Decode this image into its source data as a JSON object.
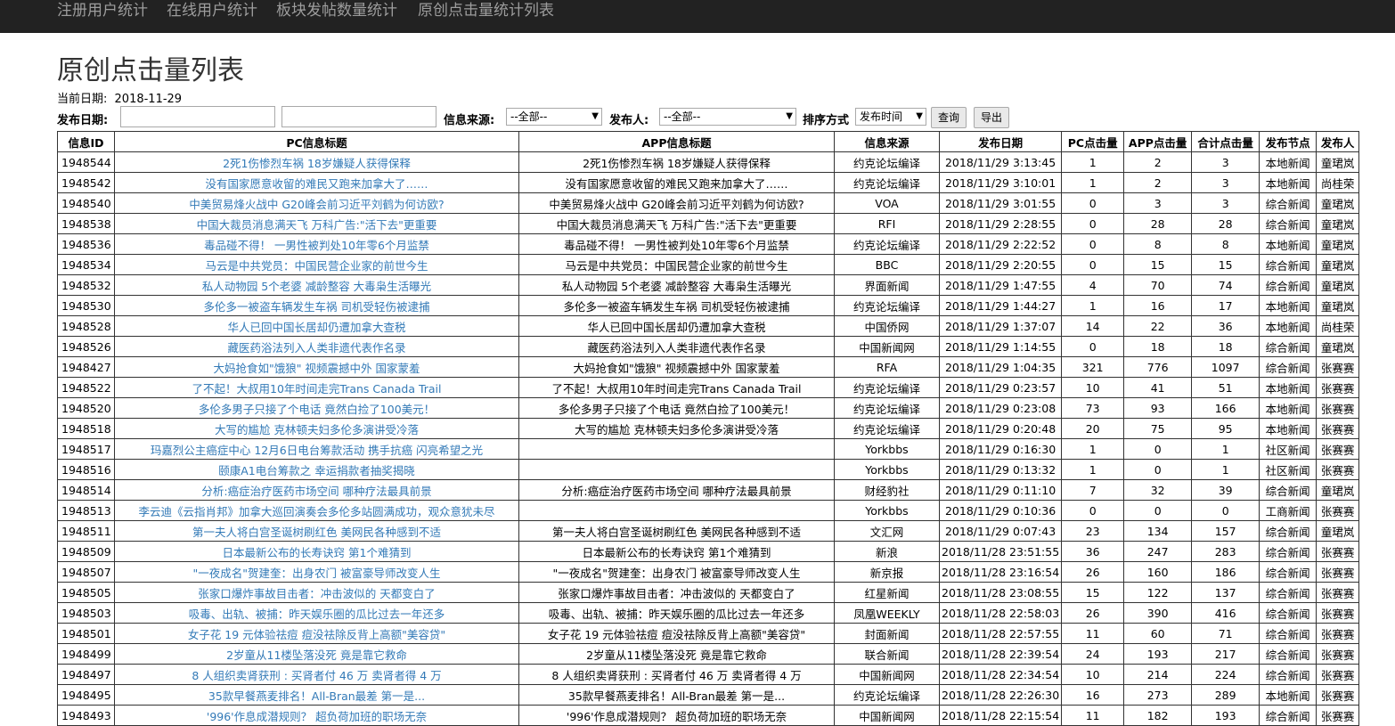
{
  "nav": {
    "items": [
      {
        "label": "注册用户统计"
      },
      {
        "label": "在线用户统计"
      },
      {
        "label": "板块发帖数量统计"
      },
      {
        "label": "原创点击量统计列表"
      }
    ]
  },
  "page_title": "原创点击量列表",
  "current_date": {
    "label": "当前日期:",
    "value": "2018-11-29"
  },
  "filters": {
    "publish_date_label": "发布日期:",
    "source_label": "信息来源:",
    "source_value": "--全部--",
    "publisher_label": "发布人:",
    "publisher_value": "--全部--",
    "sort_label": "排序方式",
    "sort_value": "发布时间",
    "query_button": "查询",
    "export_button": "导出"
  },
  "table": {
    "headers": [
      "信息ID",
      "PC信息标题",
      "APP信息标题",
      "信息来源",
      "发布日期",
      "PC点击量",
      "APP点击量",
      "合计点击量",
      "发布节点",
      "发布人"
    ],
    "rows": [
      [
        "1948544",
        "2死1伤惨烈车祸 18岁嫌疑人获得保释",
        "2死1伤惨烈车祸 18岁嫌疑人获得保释",
        "约克论坛编译",
        "2018/11/29 3:13:45",
        "1",
        "2",
        "3",
        "本地新闻",
        "童珺岚"
      ],
      [
        "1948542",
        "没有国家愿意收留的难民又跑来加拿大了……",
        "没有国家愿意收留的难民又跑来加拿大了……",
        "约克论坛编译",
        "2018/11/29 3:10:01",
        "1",
        "2",
        "3",
        "本地新闻",
        "尚桂荣"
      ],
      [
        "1948540",
        "中美贸易烽火战中 G20峰会前习近平刘鹤为何访欧?",
        "中美贸易烽火战中 G20峰会前习近平刘鹤为何访欧?",
        "VOA",
        "2018/11/29 3:01:55",
        "0",
        "3",
        "3",
        "综合新闻",
        "童珺岚"
      ],
      [
        "1948538",
        "中国大裁员消息满天飞 万科广告:\"活下去\"更重要",
        "中国大裁员消息满天飞 万科广告:\"活下去\"更重要",
        "RFI",
        "2018/11/29 2:28:55",
        "0",
        "28",
        "28",
        "综合新闻",
        "童珺岚"
      ],
      [
        "1948536",
        "毒品碰不得！ 一男性被判处10年零6个月监禁",
        "毒品碰不得！ 一男性被判处10年零6个月监禁",
        "约克论坛编译",
        "2018/11/29 2:22:52",
        "0",
        "8",
        "8",
        "本地新闻",
        "童珺岚"
      ],
      [
        "1948534",
        "马云是中共党员：中国民营企业家的前世今生",
        "马云是中共党员：中国民营企业家的前世今生",
        "BBC",
        "2018/11/29 2:20:55",
        "0",
        "15",
        "15",
        "综合新闻",
        "童珺岚"
      ],
      [
        "1948532",
        "私人动物园 5个老婆 减龄整容 大毒枭生活曝光",
        "私人动物园 5个老婆 减龄整容 大毒枭生活曝光",
        "界面新闻",
        "2018/11/29 1:47:55",
        "4",
        "70",
        "74",
        "综合新闻",
        "童珺岚"
      ],
      [
        "1948530",
        "多伦多一被盗车辆发生车祸 司机受轻伤被逮捕",
        "多伦多一被盗车辆发生车祸 司机受轻伤被逮捕",
        "约克论坛编译",
        "2018/11/29 1:44:27",
        "1",
        "16",
        "17",
        "本地新闻",
        "童珺岚"
      ],
      [
        "1948528",
        "华人已回中国长居却仍遭加拿大查税",
        "华人已回中国长居却仍遭加拿大查税",
        "中国侨网",
        "2018/11/29 1:37:07",
        "14",
        "22",
        "36",
        "本地新闻",
        "尚桂荣"
      ],
      [
        "1948526",
        "藏医药浴法列入人类非遗代表作名录",
        "藏医药浴法列入人类非遗代表作名录",
        "中国新闻网",
        "2018/11/29 1:14:55",
        "0",
        "18",
        "18",
        "综合新闻",
        "童珺岚"
      ],
      [
        "1948427",
        "大妈抢食如\"饿狼\" 视频震撼中外 国家蒙羞",
        "大妈抢食如\"饿狼\" 视频震撼中外 国家蒙羞",
        "RFA",
        "2018/11/29 1:04:35",
        "321",
        "776",
        "1097",
        "综合新闻",
        "张赛赛"
      ],
      [
        "1948522",
        "了不起！大叔用10年时间走完Trans Canada Trail",
        "了不起！大叔用10年时间走完Trans Canada Trail",
        "约克论坛编译",
        "2018/11/29 0:23:57",
        "10",
        "41",
        "51",
        "本地新闻",
        "张赛赛"
      ],
      [
        "1948520",
        "多伦多男子只接了个电话 竟然白捡了100美元！",
        "多伦多男子只接了个电话 竟然白捡了100美元！",
        "约克论坛编译",
        "2018/11/29 0:23:08",
        "73",
        "93",
        "166",
        "本地新闻",
        "张赛赛"
      ],
      [
        "1948518",
        "大写的尴尬 克林顿夫妇多伦多演讲受冷落",
        "大写的尴尬 克林顿夫妇多伦多演讲受冷落",
        "约克论坛编译",
        "2018/11/29 0:20:48",
        "20",
        "75",
        "95",
        "本地新闻",
        "张赛赛"
      ],
      [
        "1948517",
        "玛嘉烈公主癌症中心 12月6日电台筹款活动 携手抗癌 闪亮希望之光",
        "",
        "Yorkbbs",
        "2018/11/29 0:16:30",
        "1",
        "0",
        "1",
        "社区新闻",
        "张赛赛"
      ],
      [
        "1948516",
        "颐康A1电台筹款之 幸运捐款者抽奖揭晓",
        "",
        "Yorkbbs",
        "2018/11/29 0:13:32",
        "1",
        "0",
        "1",
        "社区新闻",
        "张赛赛"
      ],
      [
        "1948514",
        "分析:癌症治疗医药市场空间 哪种疗法最具前景",
        "分析:癌症治疗医药市场空间 哪种疗法最具前景",
        "财经豹社",
        "2018/11/29 0:11:10",
        "7",
        "32",
        "39",
        "综合新闻",
        "童珺岚"
      ],
      [
        "1948513",
        "李云迪《云指肖邦》加拿大巡回演奏会多伦多站圆满成功，观众意犹未尽",
        "",
        "Yorkbbs",
        "2018/11/29 0:10:36",
        "0",
        "0",
        "0",
        "工商新闻",
        "张赛赛"
      ],
      [
        "1948511",
        "第一夫人将白宫圣诞树刷红色 美网民各种感到不适",
        "第一夫人将白宫圣诞树刷红色 美网民各种感到不适",
        "文汇网",
        "2018/11/29 0:07:43",
        "23",
        "134",
        "157",
        "综合新闻",
        "童珺岚"
      ],
      [
        "1948509",
        "日本最新公布的长寿诀窍 第1个难猜到",
        "日本最新公布的长寿诀窍 第1个难猜到",
        "新浪",
        "2018/11/28 23:51:55",
        "36",
        "247",
        "283",
        "综合新闻",
        "张赛赛"
      ],
      [
        "1948507",
        "\"一夜成名\"贺建奎：出身农门 被富豪导师改变人生",
        "\"一夜成名\"贺建奎：出身农门 被富豪导师改变人生",
        "新京报",
        "2018/11/28 23:16:54",
        "26",
        "160",
        "186",
        "综合新闻",
        "张赛赛"
      ],
      [
        "1948505",
        "张家口爆炸事故目击者：冲击波似的 天都变白了",
        "张家口爆炸事故目击者：冲击波似的 天都变白了",
        "红星新闻",
        "2018/11/28 23:08:55",
        "15",
        "122",
        "137",
        "综合新闻",
        "张赛赛"
      ],
      [
        "1948503",
        "吸毒、出轨、被捕：昨天娱乐圈的瓜比过去一年还多",
        "吸毒、出轨、被捕：昨天娱乐圈的瓜比过去一年还多",
        "凤凰WEEKLY",
        "2018/11/28 22:58:03",
        "26",
        "390",
        "416",
        "综合新闻",
        "张赛赛"
      ],
      [
        "1948501",
        "女子花 19 元体验祛痘 痘没祛除反背上高额\"美容贷\"",
        "女子花 19 元体验祛痘 痘没祛除反背上高额\"美容贷\"",
        "封面新闻",
        "2018/11/28 22:57:55",
        "11",
        "60",
        "71",
        "综合新闻",
        "张赛赛"
      ],
      [
        "1948499",
        "2岁童从11楼坠落没死 竟是靠它救命",
        "2岁童从11楼坠落没死 竟是靠它救命",
        "联合新闻",
        "2018/11/28 22:39:54",
        "24",
        "193",
        "217",
        "综合新闻",
        "张赛赛"
      ],
      [
        "1948497",
        "8 人组织卖肾获刑 : 买肾者付 46 万 卖肾者得 4 万",
        "8 人组织卖肾获刑 : 买肾者付 46 万 卖肾者得 4 万",
        "中国新闻网",
        "2018/11/28 22:34:54",
        "10",
        "214",
        "224",
        "综合新闻",
        "张赛赛"
      ],
      [
        "1948495",
        "35款早餐燕麦排名！All-Bran最差 第一是...",
        "35款早餐燕麦排名！All-Bran最差 第一是...",
        "约克论坛编译",
        "2018/11/28 22:26:30",
        "16",
        "273",
        "289",
        "本地新闻",
        "张赛赛"
      ],
      [
        "1948493",
        "'996'作息成潜规则？ 超负荷加班的职场无奈",
        "'996'作息成潜规则？ 超负荷加班的职场无奈",
        "中国新闻网",
        "2018/11/28 22:15:54",
        "11",
        "182",
        "193",
        "综合新闻",
        "张赛赛"
      ]
    ]
  }
}
